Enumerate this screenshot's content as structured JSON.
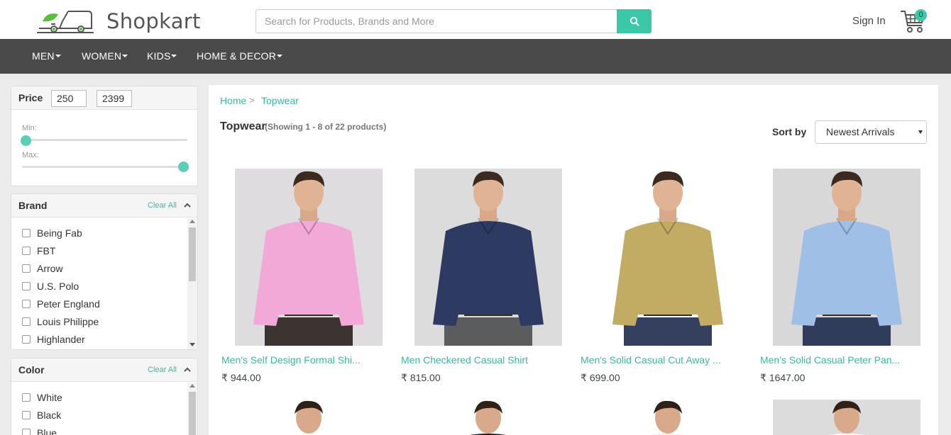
{
  "header": {
    "brand": "Shopkart",
    "search_placeholder": "Search for Products, Brands and More",
    "signin_label": "Sign In",
    "cart_count": "0"
  },
  "nav": {
    "items": [
      "MEN",
      "WOMEN",
      "KIDS",
      "HOME & DECOR"
    ]
  },
  "price_filter": {
    "title": "Price",
    "min_value": "250",
    "max_value": "2399",
    "min_label": "Min:",
    "max_label": "Max:",
    "min_fraction": 0.0,
    "max_fraction": 1.0
  },
  "brand_filter": {
    "title": "Brand",
    "clear_label": "Clear All",
    "options": [
      "Being Fab",
      "FBT",
      "Arrow",
      "U.S. Polo",
      "Peter England",
      "Louis Philippe",
      "Highlander"
    ]
  },
  "color_filter": {
    "title": "Color",
    "clear_label": "Clear All",
    "options": [
      "White",
      "Black",
      "Blue"
    ]
  },
  "breadcrumb": {
    "home": "Home",
    "separator": ">",
    "current": "Topwear"
  },
  "listing": {
    "title": "Topwear",
    "showing": "(Showing 1 - 8 of 22 products)",
    "sort_label": "Sort by",
    "sort_value": "Newest Arrivals"
  },
  "products": [
    {
      "name": "Men's Self Design Formal Shi...",
      "price": "944.00",
      "shirt_color": "#f3a9d7",
      "bg": "#dedcdf",
      "pants": "#3c3431"
    },
    {
      "name": "Men Checkered Casual Shirt",
      "price": "815.00",
      "shirt_color": "#2d3a62",
      "bg": "#dcdcdc",
      "pants": "#5a5c5e"
    },
    {
      "name": "Men's Solid Casual Cut Away ...",
      "price": "699.00",
      "shirt_color": "#c2ab63",
      "bg": "#ffffff",
      "pants": "#34405e"
    },
    {
      "name": "Men's Solid Casual Peter Pan...",
      "price": "1647.00",
      "shirt_color": "#9fbfe6",
      "bg": "#d8d8d8",
      "pants": "#2f3d5a"
    }
  ],
  "currency_symbol": "₹",
  "colors": {
    "accent": "#3cc7a8",
    "nav_bg": "#4a4a4a"
  }
}
